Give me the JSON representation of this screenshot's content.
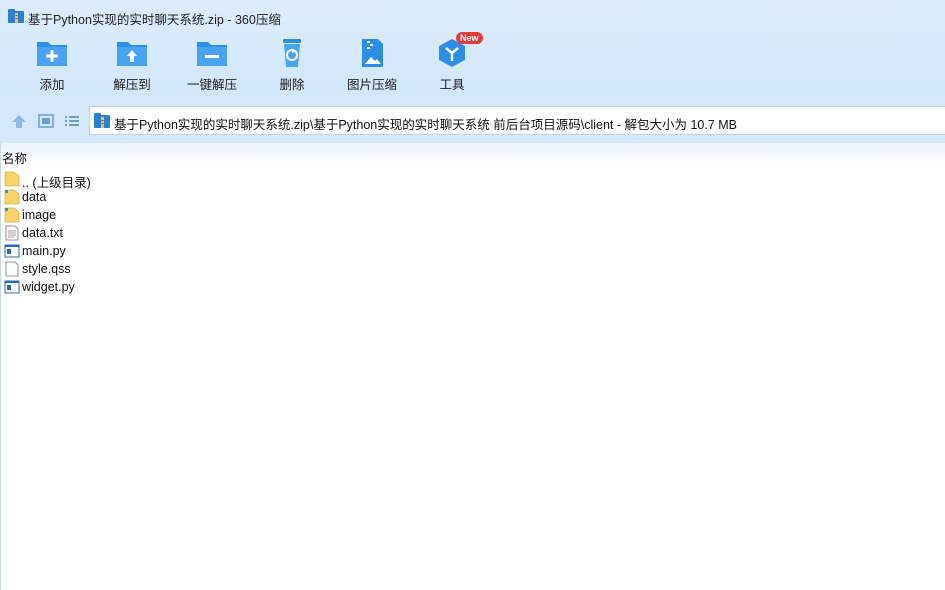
{
  "window": {
    "title": "基于Python实现的实时聊天系统.zip - 360压缩"
  },
  "toolbar": {
    "items": [
      {
        "label": "添加",
        "icon": "add-folder-icon"
      },
      {
        "label": "解压到",
        "icon": "extract-to-folder-icon"
      },
      {
        "label": "一键解压",
        "icon": "one-click-extract-icon"
      },
      {
        "label": "删除",
        "icon": "delete-bin-icon"
      },
      {
        "label": "图片压缩",
        "icon": "image-compress-icon"
      },
      {
        "label": "工具",
        "icon": "tools-cube-icon",
        "badge": "New"
      }
    ]
  },
  "nav": {
    "address": "基于Python实现的实时聊天系统.zip\\基于Python实现的实时聊天系统 前后台项目源码\\client - 解包大小为 10.7 MB"
  },
  "list": {
    "column_name": "名称",
    "rows": [
      {
        "name": ".. (上级目录)",
        "icon": "folder-up-icon"
      },
      {
        "name": "data",
        "icon": "folder-zip-icon"
      },
      {
        "name": "image",
        "icon": "folder-zip-icon"
      },
      {
        "name": "data.txt",
        "icon": "text-file-icon"
      },
      {
        "name": "main.py",
        "icon": "python-file-icon"
      },
      {
        "name": "style.qss",
        "icon": "blank-file-icon"
      },
      {
        "name": "widget.py",
        "icon": "python-file-icon"
      }
    ]
  },
  "colors": {
    "accent": "#2d8ee8",
    "header_bg": "#d6e9fb",
    "badge": "#e83a3a"
  }
}
